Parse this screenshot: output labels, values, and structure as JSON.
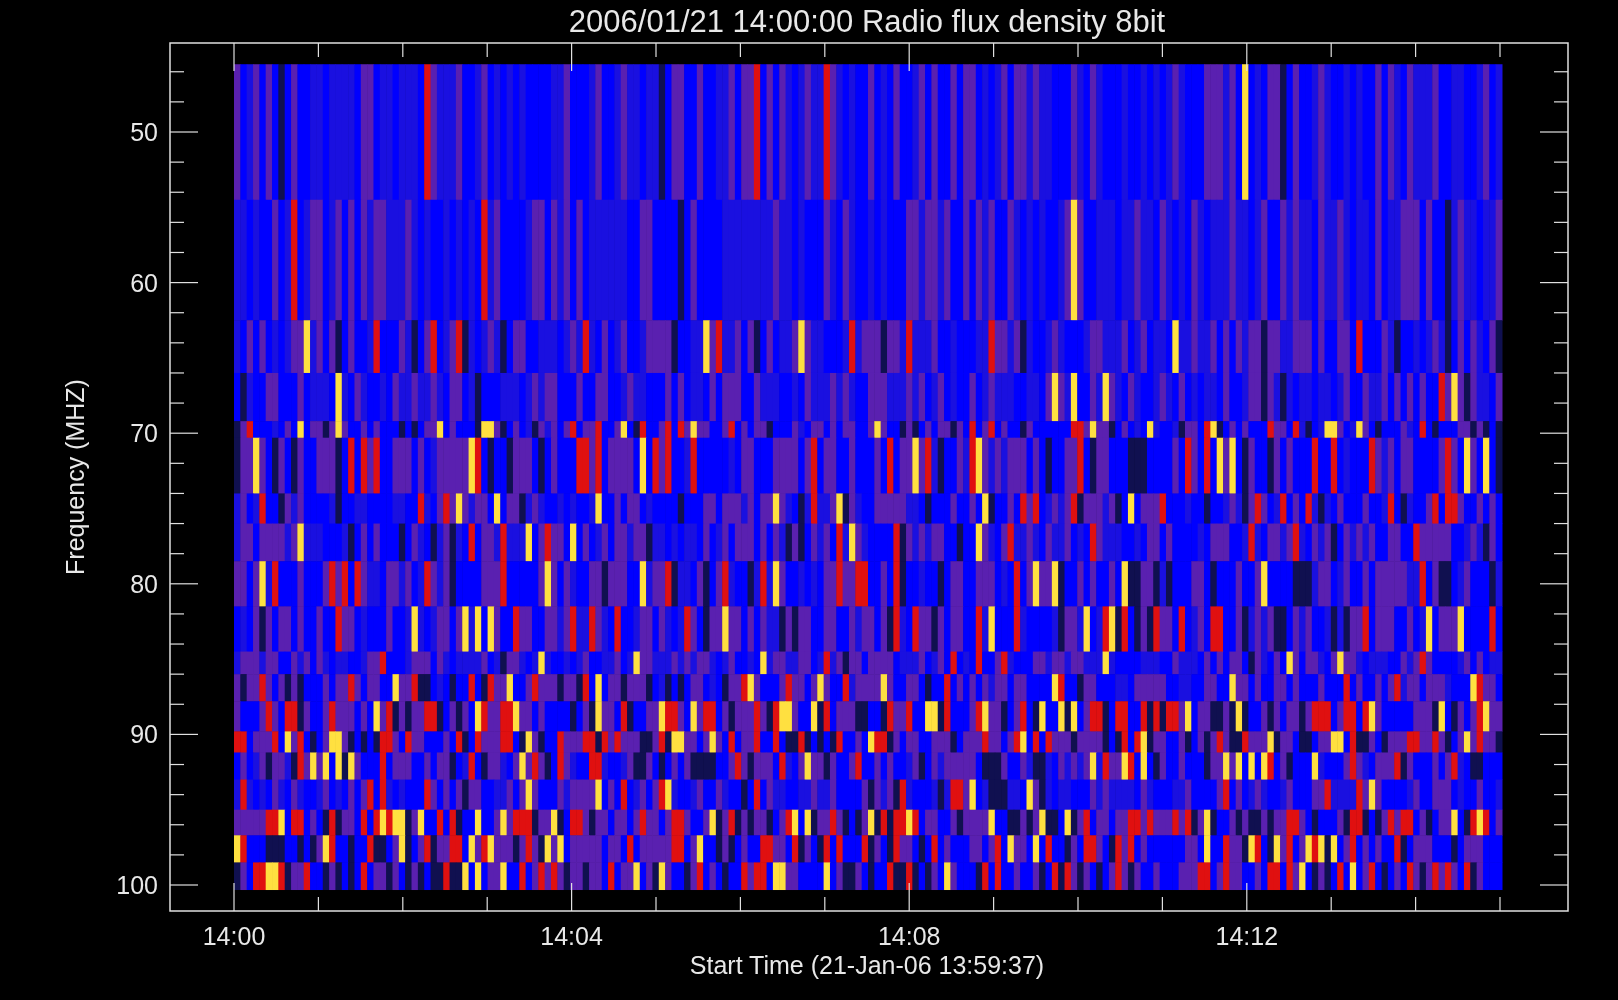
{
  "title": "2006/01/21 14:00:00 Radio flux density 8bit",
  "y_axis": {
    "label": "Frequency (MHZ)",
    "ticks": [
      "50",
      "60",
      "70",
      "80",
      "90",
      "100"
    ]
  },
  "x_axis": {
    "label": "Start Time (21-Jan-06 13:59:37)",
    "ticks": [
      "14:00",
      "14:04",
      "14:08",
      "14:12"
    ]
  }
}
